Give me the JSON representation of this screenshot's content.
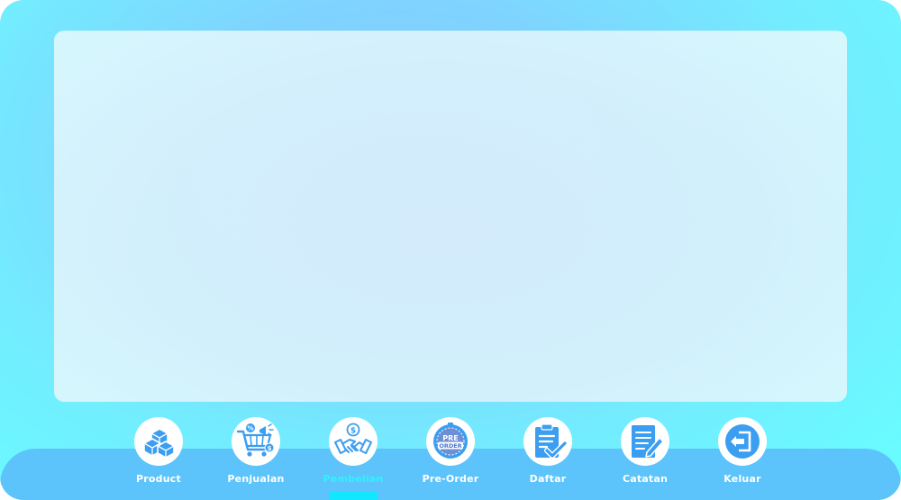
{
  "colors": {
    "accent": "#3c9ef0",
    "active_label": "#2ff2ff",
    "bottom_bar": "#5cc3fb"
  },
  "nav": {
    "active": "Pembelian",
    "items": [
      {
        "label": "Product",
        "icon": "boxes-icon"
      },
      {
        "label": "Penjualan",
        "icon": "shopping-cart-icon"
      },
      {
        "label": "Pembelian",
        "icon": "handshake-dollar-icon"
      },
      {
        "label": "Pre-Order",
        "icon": "pre-order-badge-icon"
      },
      {
        "label": "Daftar",
        "icon": "clipboard-check-icon"
      },
      {
        "label": "Catatan",
        "icon": "notepad-pencil-icon"
      },
      {
        "label": "Keluar",
        "icon": "logout-icon"
      }
    ]
  }
}
